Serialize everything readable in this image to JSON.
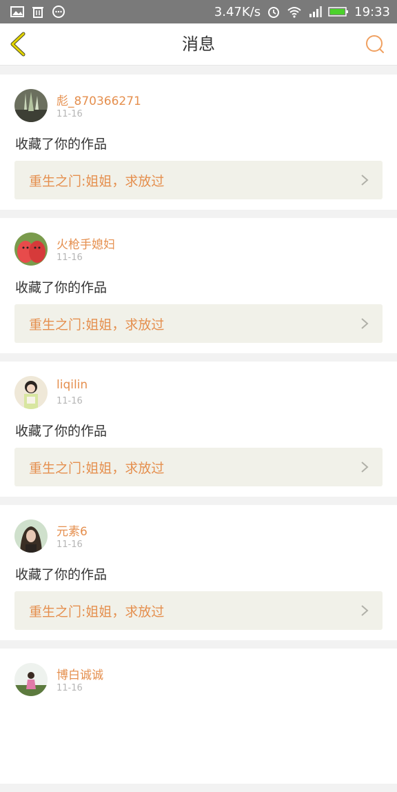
{
  "status_bar": {
    "network_speed": "3.47K/s",
    "time": "19:33",
    "icons": [
      "image-icon",
      "trash-icon",
      "chat-bubble-icon",
      "alarm-icon",
      "wifi-icon",
      "signal-icon",
      "battery-icon"
    ]
  },
  "header": {
    "title": "消息",
    "back_icon": "chevron-left-icon",
    "search_icon": "search-icon"
  },
  "colors": {
    "accent": "#e58f4e",
    "back_arrow": "#c9b400",
    "work_bg": "#f1f1e9"
  },
  "messages": [
    {
      "username": "彪_870366271",
      "date": "11-16",
      "action": "收藏了你的作品",
      "work_title": "重生之门:姐姐，求放过"
    },
    {
      "username": "火枪手媳妇",
      "date": "11-16",
      "action": "收藏了你的作品",
      "work_title": "重生之门:姐姐，求放过"
    },
    {
      "username": "liqilin",
      "date": "11-16",
      "action": "收藏了你的作品",
      "work_title": "重生之门:姐姐，求放过"
    },
    {
      "username": "元素6",
      "date": "11-16",
      "action": "收藏了你的作品",
      "work_title": "重生之门:姐姐，求放过"
    },
    {
      "username": "博白诚诚",
      "date": "11-16",
      "action": "",
      "work_title": ""
    }
  ]
}
